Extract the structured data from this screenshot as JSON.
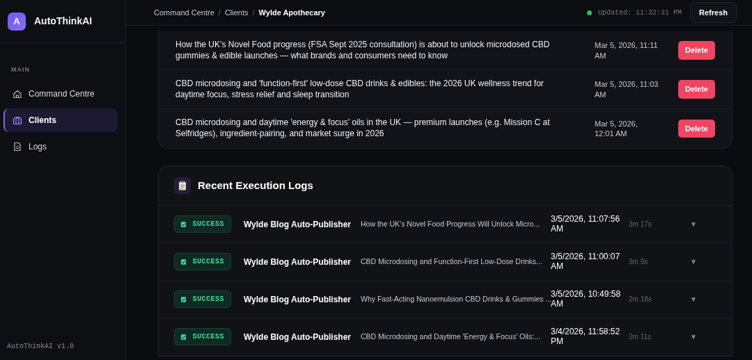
{
  "sidebar": {
    "logo_letter": "A",
    "brand": "AutoThinkAI",
    "section": "MAIN",
    "items": [
      {
        "label": "Command Centre",
        "selected": false
      },
      {
        "label": "Clients",
        "selected": true
      },
      {
        "label": "Logs",
        "selected": false
      }
    ],
    "version": "AutoThinkAI v1.0"
  },
  "breadcrumb": [
    {
      "label": "Command Centre"
    },
    {
      "separator": "/",
      "label": "Clients"
    },
    {
      "separator": "/",
      "label": "Wylde Apothecary"
    }
  ],
  "status": {
    "online": true,
    "updated": "Updated: 11:32:31 PM"
  },
  "refresh_button": "Refresh",
  "posts": [
    {
      "title": "How the UK’s Novel Food progress (FSA Sept 2025 consultation) is about to unlock microdosed CBD gummies & edible launches — what brands and consumers need to know",
      "date": "Mar 5, 2026, 11:11 AM",
      "action": "Delete"
    },
    {
      "title": "CBD microdosing and 'function-first' low-dose CBD drinks & edibles: the 2026 UK wellness trend for daytime focus, stress relief and sleep transition",
      "date": "Mar 5, 2026, 11:03 AM",
      "action": "Delete"
    },
    {
      "title": "CBD microdosing and daytime 'energy & focus' oils in the UK — premium launches (e.g. Mission C at Selfridges), ingredient-pairing, and market surge in 2026",
      "date": "Mar 5, 2026, 12:01 AM",
      "action": "Delete"
    }
  ],
  "logs": {
    "title": "Recent Execution Logs",
    "rows": [
      {
        "status": "SUCCESS",
        "workflow": "Wylde Blog Auto-Publisher",
        "output": "How the UK’s Novel Food Progress Will Unlock Micro...",
        "time": "3/5/2026, 11:07:56 AM",
        "duration": "3m 17s",
        "expand": "▼"
      },
      {
        "status": "SUCCESS",
        "workflow": "Wylde Blog Auto-Publisher",
        "output": "CBD Microdosing and Function-First Low-Dose Drinks...",
        "time": "3/5/2026, 11:00:07 AM",
        "duration": "3m 9s",
        "expand": "▼"
      },
      {
        "status": "SUCCESS",
        "workflow": "Wylde Blog Auto-Publisher",
        "output": "Why Fast-Acting Nanoemulsion CBD Drinks & Gummies ...",
        "time": "3/5/2026, 10:49:58 AM",
        "duration": "2m 18s",
        "expand": "▼"
      },
      {
        "status": "SUCCESS",
        "workflow": "Wylde Blog Auto-Publisher",
        "output": "CBD Microdosing and Daytime 'Energy & Focus' Oils:...",
        "time": "3/4/2026, 11:58:52 PM",
        "duration": "2m 11s",
        "expand": "▼"
      }
    ]
  }
}
